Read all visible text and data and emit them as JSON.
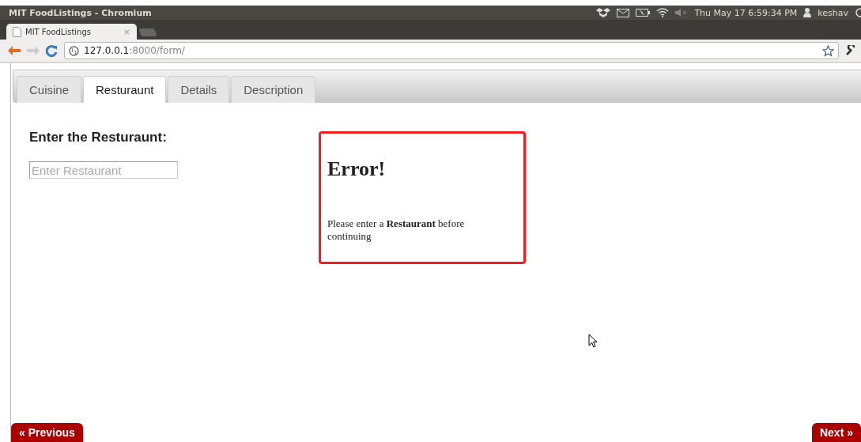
{
  "window": {
    "title": "MIT FoodListings - Chromium"
  },
  "top_panel": {
    "clock": "Thu May 17  6:59:34 PM",
    "user": "keshav"
  },
  "browser_tab": {
    "title": "MIT FoodListings",
    "close": "×"
  },
  "address_bar": {
    "host": "127.0.0.1",
    "path": ":8000/form/"
  },
  "page": {
    "tabs": [
      {
        "label": "Cuisine",
        "selected": false
      },
      {
        "label": "Resturaunt",
        "selected": true
      },
      {
        "label": "Details",
        "selected": false
      },
      {
        "label": "Description",
        "selected": false
      }
    ],
    "heading": "Enter the Resturaunt:",
    "field": {
      "placeholder": "Enter Restaurant"
    },
    "error": {
      "title": "Error!",
      "message": "Please enter a **Restaurant** before continuing"
    },
    "buttons": [
      {
        "label": "« Previous"
      },
      {
        "label": "Next »"
      }
    ]
  }
}
